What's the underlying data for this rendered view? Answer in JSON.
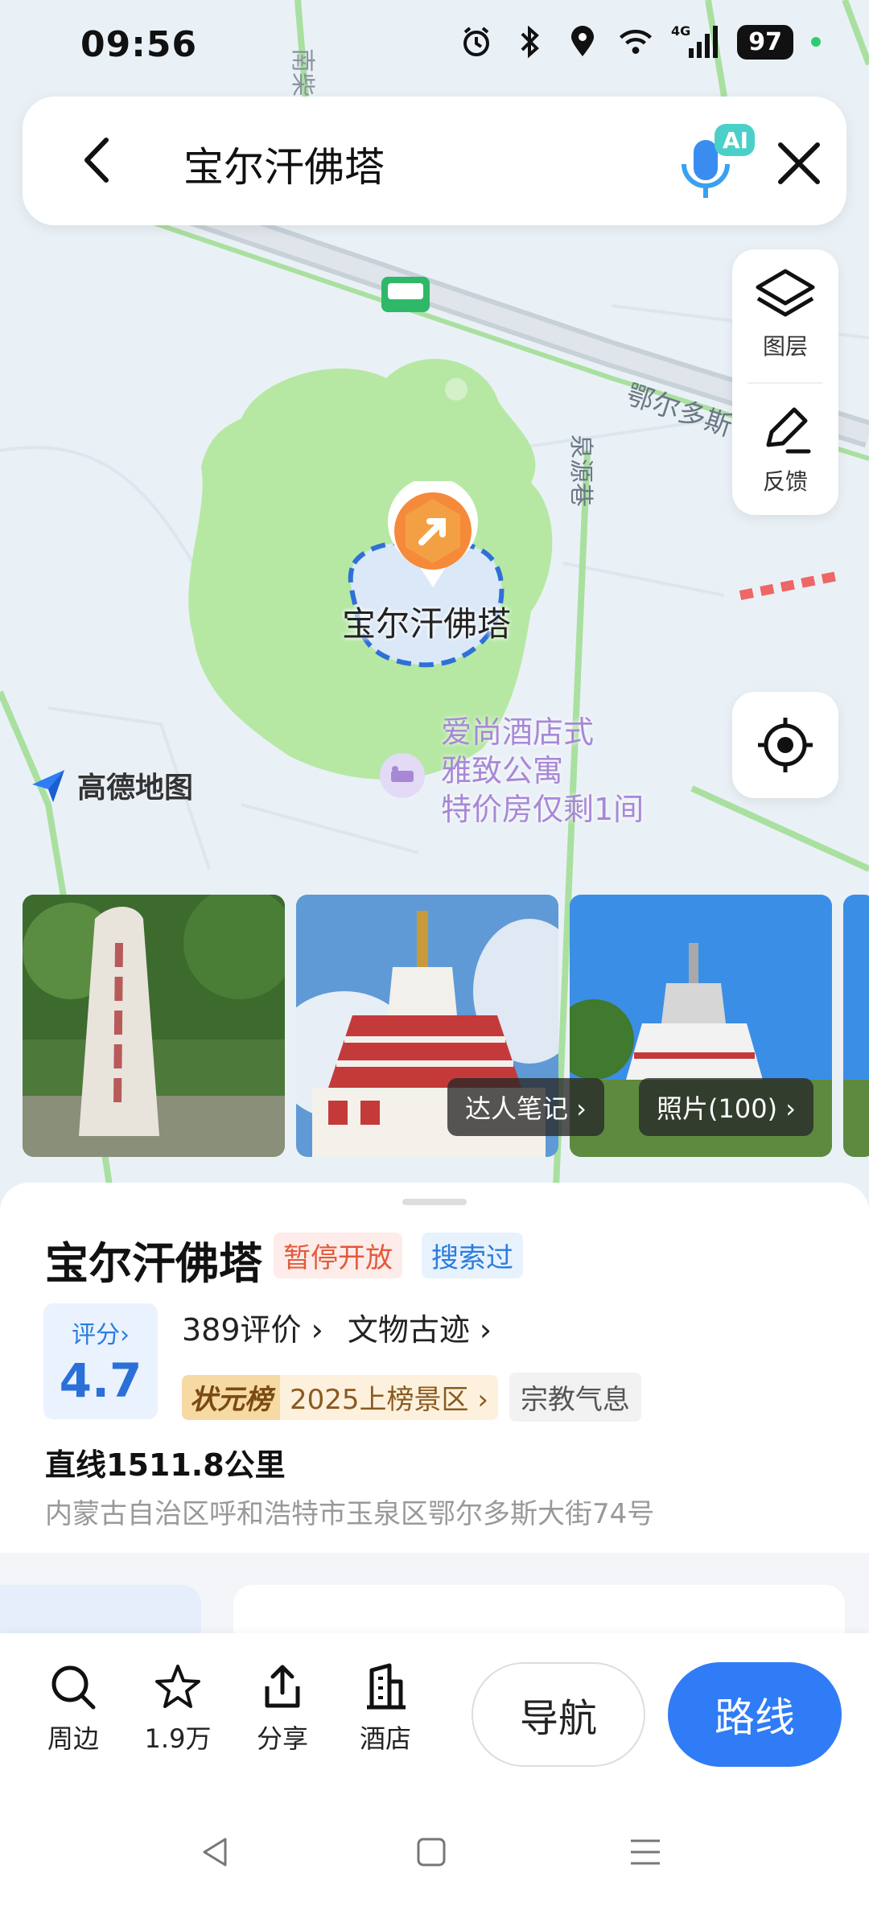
{
  "status_bar": {
    "time": "09:56",
    "battery": "97",
    "network": "4G"
  },
  "search": {
    "query": "宝尔汗佛塔",
    "ai_badge": "AI"
  },
  "map": {
    "poi_name": "宝尔汗佛塔",
    "street_label": "鄂尔多斯",
    "street_label_2": "南柴火",
    "lane_label": "泉源巷",
    "hotel_ad_lines": [
      "爱尚酒店式",
      "雅致公寓",
      "特价房仅剩1间"
    ],
    "logo_text": "高德地图",
    "layer_label": "图层",
    "feedback_label": "反馈"
  },
  "photos": {
    "notes_tag": "达人笔记 ›",
    "photos_tag": "照片(100) ›"
  },
  "place": {
    "name": "宝尔汗佛塔",
    "status_tag": "暂停开放",
    "searched_tag": "搜索过",
    "score_label": "评分›",
    "score_value": "4.7",
    "reviews": "389评价 ›",
    "category": "文物古迹 ›",
    "rank_badge": "状元榜",
    "rank_text": "2025上榜景区 ›",
    "feature_tag": "宗教气息",
    "distance": "直线1511.8公里",
    "address": "内蒙古自治区呼和浩特市玉泉区鄂尔多斯大街74号"
  },
  "actions": {
    "nearby": "周边",
    "favorites": "1.9万",
    "share": "分享",
    "hotel": "酒店",
    "navigate": "导航",
    "route": "路线"
  },
  "colors": {
    "accent": "#2f7cf6",
    "closed": "#e35a3b",
    "park_green": "#b6e8a4"
  }
}
